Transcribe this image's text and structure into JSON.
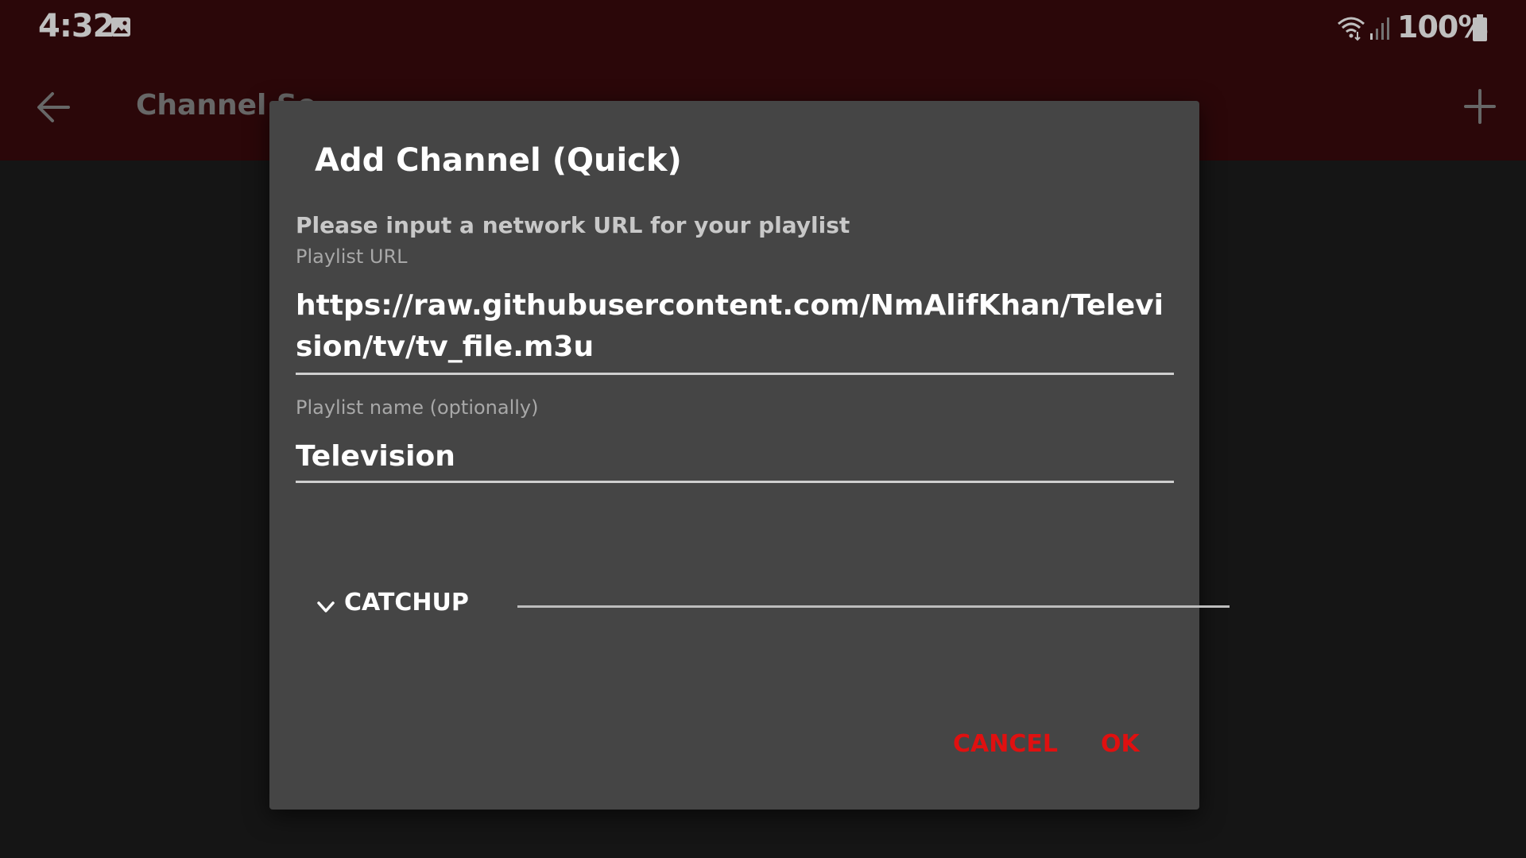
{
  "status_bar": {
    "time": "4:32",
    "battery_percent": "100%",
    "icons": [
      "gallery-icon",
      "wifi-icon",
      "signal-icon",
      "battery-icon"
    ]
  },
  "app_bar": {
    "title": "Channel Se",
    "back_icon": "arrow-left-icon",
    "add_icon": "plus-icon",
    "background_color": "#3a0a0c"
  },
  "dialog": {
    "title": "Add Channel (Quick)",
    "message": "Please input a network URL for your playlist",
    "url_field": {
      "label": "Playlist URL",
      "value": "https://raw.githubusercontent.com/NmAlifKhan/Television/tv/tv_file.m3u"
    },
    "name_field": {
      "label": "Playlist name (optionally)",
      "value": "Television"
    },
    "catchup": {
      "label": "CATCHUP",
      "icon": "chevron-down-icon"
    },
    "buttons": {
      "cancel": "CANCEL",
      "ok": "OK"
    },
    "accent_color": "#e01010",
    "background_color": "#454545"
  }
}
